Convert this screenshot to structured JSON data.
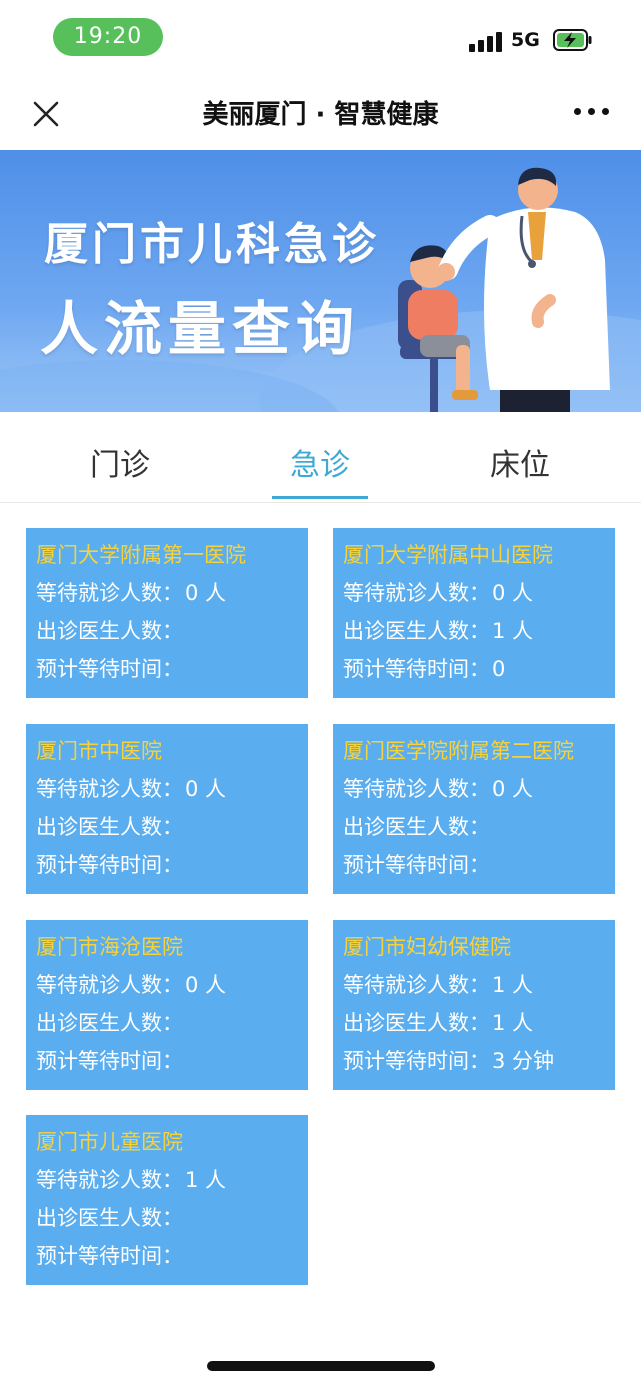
{
  "status_bar": {
    "time": "19:20",
    "network": "5G"
  },
  "nav": {
    "title": "美丽厦门 · 智慧健康"
  },
  "banner": {
    "line1": "厦门市儿科急诊",
    "line2": "人流量查询"
  },
  "tabs": [
    {
      "label": "门诊",
      "active": false
    },
    {
      "label": "急诊",
      "active": true
    },
    {
      "label": "床位",
      "active": false
    }
  ],
  "labels": {
    "waiting": "等待就诊人数：",
    "doctors": "出诊医生人数：",
    "wait_time": "预计等待时间："
  },
  "hospitals": [
    {
      "name": "厦门大学附属第一医院",
      "waiting": "0 人",
      "doctors": "",
      "wait_time": ""
    },
    {
      "name": "厦门大学附属中山医院",
      "waiting": "0 人",
      "doctors": "1 人",
      "wait_time": "0"
    },
    {
      "name": "厦门市中医院",
      "waiting": "0 人",
      "doctors": "",
      "wait_time": ""
    },
    {
      "name": "厦门医学院附属第二医院",
      "waiting": "0 人",
      "doctors": "",
      "wait_time": ""
    },
    {
      "name": "厦门市海沧医院",
      "waiting": "0 人",
      "doctors": "",
      "wait_time": ""
    },
    {
      "name": "厦门市妇幼保健院",
      "waiting": "1 人",
      "doctors": "1 人",
      "wait_time": "3 分钟"
    },
    {
      "name": "厦门市儿童医院",
      "waiting": "1 人",
      "doctors": "",
      "wait_time": ""
    }
  ],
  "colors": {
    "card_bg": "#5aaef0",
    "hospital_name": "#f6d23b",
    "active_tab": "#3fa9d6",
    "time_pill": "#57c05b"
  }
}
